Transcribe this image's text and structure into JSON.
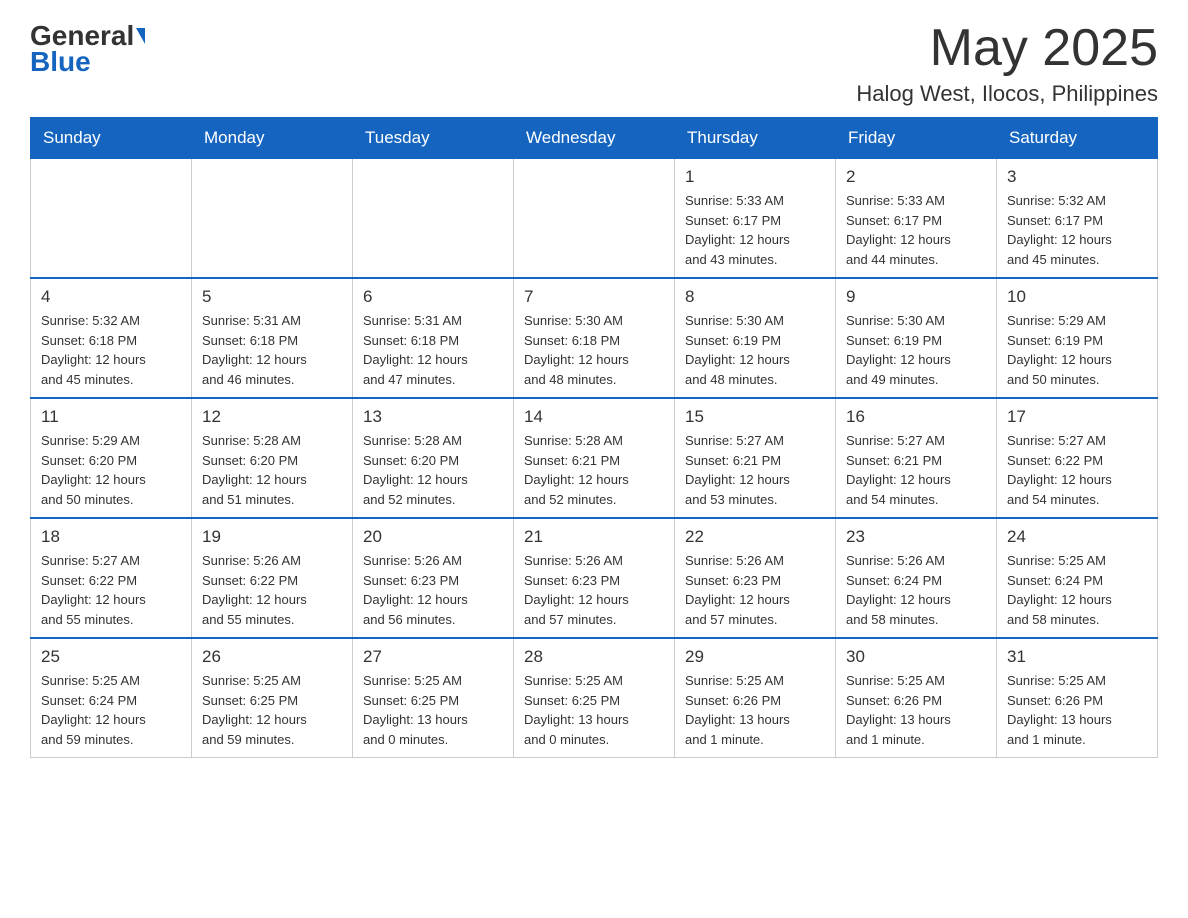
{
  "header": {
    "logo_general": "General",
    "logo_blue": "Blue",
    "month_year": "May 2025",
    "location": "Halog West, Ilocos, Philippines"
  },
  "weekdays": [
    "Sunday",
    "Monday",
    "Tuesday",
    "Wednesday",
    "Thursday",
    "Friday",
    "Saturday"
  ],
  "weeks": [
    {
      "days": [
        {
          "number": "",
          "info": ""
        },
        {
          "number": "",
          "info": ""
        },
        {
          "number": "",
          "info": ""
        },
        {
          "number": "",
          "info": ""
        },
        {
          "number": "1",
          "info": "Sunrise: 5:33 AM\nSunset: 6:17 PM\nDaylight: 12 hours\nand 43 minutes."
        },
        {
          "number": "2",
          "info": "Sunrise: 5:33 AM\nSunset: 6:17 PM\nDaylight: 12 hours\nand 44 minutes."
        },
        {
          "number": "3",
          "info": "Sunrise: 5:32 AM\nSunset: 6:17 PM\nDaylight: 12 hours\nand 45 minutes."
        }
      ]
    },
    {
      "days": [
        {
          "number": "4",
          "info": "Sunrise: 5:32 AM\nSunset: 6:18 PM\nDaylight: 12 hours\nand 45 minutes."
        },
        {
          "number": "5",
          "info": "Sunrise: 5:31 AM\nSunset: 6:18 PM\nDaylight: 12 hours\nand 46 minutes."
        },
        {
          "number": "6",
          "info": "Sunrise: 5:31 AM\nSunset: 6:18 PM\nDaylight: 12 hours\nand 47 minutes."
        },
        {
          "number": "7",
          "info": "Sunrise: 5:30 AM\nSunset: 6:18 PM\nDaylight: 12 hours\nand 48 minutes."
        },
        {
          "number": "8",
          "info": "Sunrise: 5:30 AM\nSunset: 6:19 PM\nDaylight: 12 hours\nand 48 minutes."
        },
        {
          "number": "9",
          "info": "Sunrise: 5:30 AM\nSunset: 6:19 PM\nDaylight: 12 hours\nand 49 minutes."
        },
        {
          "number": "10",
          "info": "Sunrise: 5:29 AM\nSunset: 6:19 PM\nDaylight: 12 hours\nand 50 minutes."
        }
      ]
    },
    {
      "days": [
        {
          "number": "11",
          "info": "Sunrise: 5:29 AM\nSunset: 6:20 PM\nDaylight: 12 hours\nand 50 minutes."
        },
        {
          "number": "12",
          "info": "Sunrise: 5:28 AM\nSunset: 6:20 PM\nDaylight: 12 hours\nand 51 minutes."
        },
        {
          "number": "13",
          "info": "Sunrise: 5:28 AM\nSunset: 6:20 PM\nDaylight: 12 hours\nand 52 minutes."
        },
        {
          "number": "14",
          "info": "Sunrise: 5:28 AM\nSunset: 6:21 PM\nDaylight: 12 hours\nand 52 minutes."
        },
        {
          "number": "15",
          "info": "Sunrise: 5:27 AM\nSunset: 6:21 PM\nDaylight: 12 hours\nand 53 minutes."
        },
        {
          "number": "16",
          "info": "Sunrise: 5:27 AM\nSunset: 6:21 PM\nDaylight: 12 hours\nand 54 minutes."
        },
        {
          "number": "17",
          "info": "Sunrise: 5:27 AM\nSunset: 6:22 PM\nDaylight: 12 hours\nand 54 minutes."
        }
      ]
    },
    {
      "days": [
        {
          "number": "18",
          "info": "Sunrise: 5:27 AM\nSunset: 6:22 PM\nDaylight: 12 hours\nand 55 minutes."
        },
        {
          "number": "19",
          "info": "Sunrise: 5:26 AM\nSunset: 6:22 PM\nDaylight: 12 hours\nand 55 minutes."
        },
        {
          "number": "20",
          "info": "Sunrise: 5:26 AM\nSunset: 6:23 PM\nDaylight: 12 hours\nand 56 minutes."
        },
        {
          "number": "21",
          "info": "Sunrise: 5:26 AM\nSunset: 6:23 PM\nDaylight: 12 hours\nand 57 minutes."
        },
        {
          "number": "22",
          "info": "Sunrise: 5:26 AM\nSunset: 6:23 PM\nDaylight: 12 hours\nand 57 minutes."
        },
        {
          "number": "23",
          "info": "Sunrise: 5:26 AM\nSunset: 6:24 PM\nDaylight: 12 hours\nand 58 minutes."
        },
        {
          "number": "24",
          "info": "Sunrise: 5:25 AM\nSunset: 6:24 PM\nDaylight: 12 hours\nand 58 minutes."
        }
      ]
    },
    {
      "days": [
        {
          "number": "25",
          "info": "Sunrise: 5:25 AM\nSunset: 6:24 PM\nDaylight: 12 hours\nand 59 minutes."
        },
        {
          "number": "26",
          "info": "Sunrise: 5:25 AM\nSunset: 6:25 PM\nDaylight: 12 hours\nand 59 minutes."
        },
        {
          "number": "27",
          "info": "Sunrise: 5:25 AM\nSunset: 6:25 PM\nDaylight: 13 hours\nand 0 minutes."
        },
        {
          "number": "28",
          "info": "Sunrise: 5:25 AM\nSunset: 6:25 PM\nDaylight: 13 hours\nand 0 minutes."
        },
        {
          "number": "29",
          "info": "Sunrise: 5:25 AM\nSunset: 6:26 PM\nDaylight: 13 hours\nand 1 minute."
        },
        {
          "number": "30",
          "info": "Sunrise: 5:25 AM\nSunset: 6:26 PM\nDaylight: 13 hours\nand 1 minute."
        },
        {
          "number": "31",
          "info": "Sunrise: 5:25 AM\nSunset: 6:26 PM\nDaylight: 13 hours\nand 1 minute."
        }
      ]
    }
  ]
}
